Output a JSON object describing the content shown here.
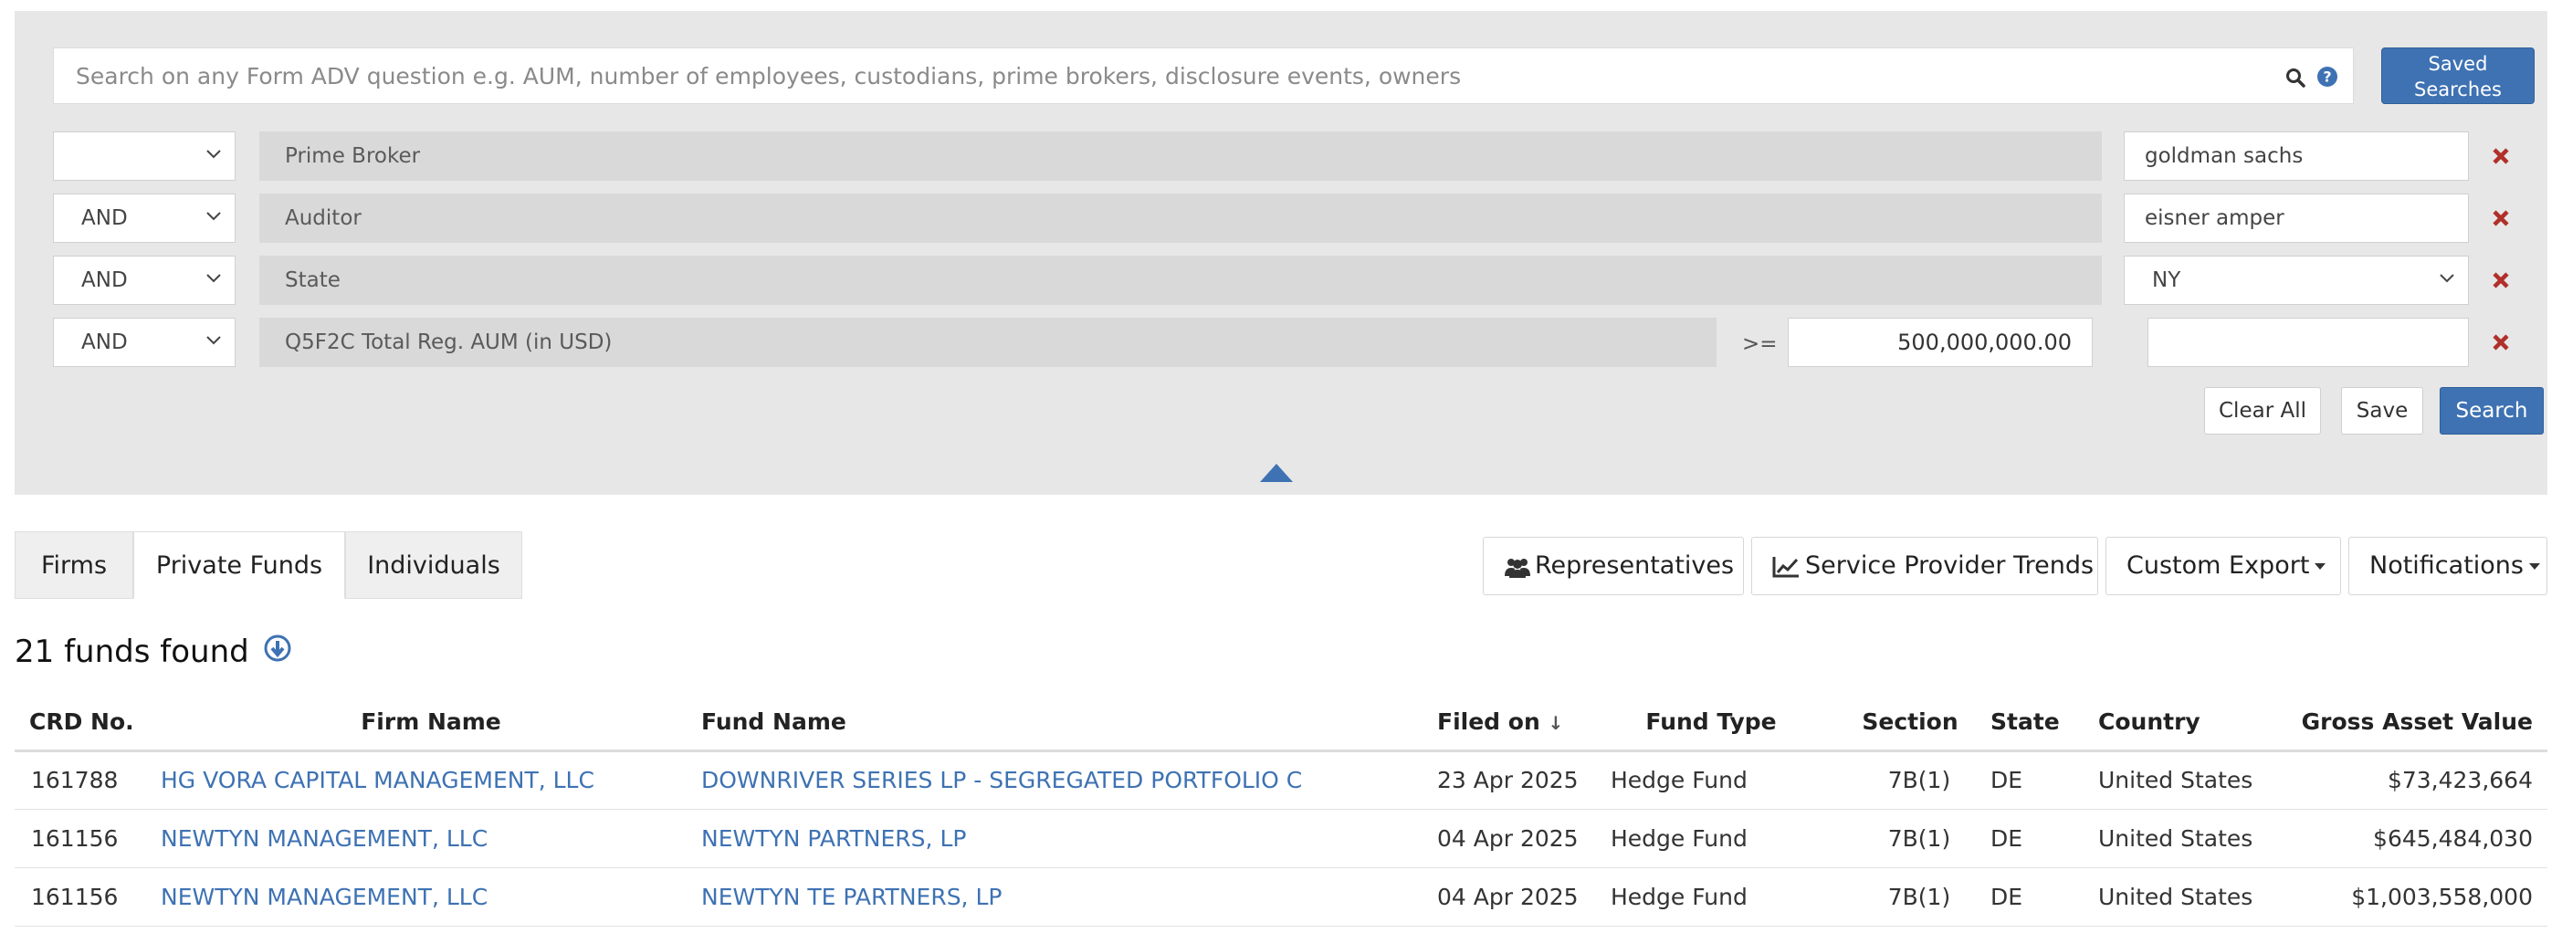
{
  "search": {
    "placeholder": "Search on any Form ADV question e.g. AUM, number of employees, custodians, prime brokers, disclosure events, owners",
    "saved_searches_line1": "Saved",
    "saved_searches_line2": "Searches",
    "search_icon": "magnifier-icon",
    "help_icon": "question-circle-icon"
  },
  "filters": [
    {
      "connector": "",
      "field": "Prime Broker",
      "value": "goldman sachs"
    },
    {
      "connector": "AND",
      "field": "Auditor",
      "value": "eisner amper"
    },
    {
      "connector": "AND",
      "field": "State",
      "value": "NY"
    },
    {
      "connector": "AND",
      "field": "Q5F2C Total Reg. AUM (in USD)",
      "operator": ">=",
      "value": "500,000,000.00",
      "value2": ""
    }
  ],
  "actions": {
    "clear_all": "Clear All",
    "save": "Save",
    "search": "Search"
  },
  "tabs": [
    {
      "label": "Firms",
      "active": false
    },
    {
      "label": "Private Funds",
      "active": true
    },
    {
      "label": "Individuals",
      "active": false
    }
  ],
  "toolbar": {
    "representatives": "Representatives",
    "service_provider_trends": "Service Provider Trends",
    "custom_export": "Custom Export",
    "notifications": "Notifications"
  },
  "results": {
    "count_label": "21 funds found"
  },
  "table": {
    "columns": [
      "CRD No.",
      "Firm Name",
      "Fund Name",
      "Filed on",
      "Fund Type",
      "Section",
      "State",
      "Country",
      "Gross Asset Value"
    ],
    "sort_indicator": "↓",
    "rows": [
      {
        "crd": "161788",
        "firm": "HG VORA CAPITAL MANAGEMENT, LLC",
        "fund": "DOWNRIVER SERIES LP - SEGREGATED PORTFOLIO C",
        "filed": "23 Apr 2025",
        "type": "Hedge Fund",
        "section": "7B(1)",
        "state": "DE",
        "country": "United States",
        "gav": "$73,423,664"
      },
      {
        "crd": "161156",
        "firm": "NEWTYN MANAGEMENT, LLC",
        "fund": "NEWTYN PARTNERS, LP",
        "filed": "04 Apr 2025",
        "type": "Hedge Fund",
        "section": "7B(1)",
        "state": "DE",
        "country": "United States",
        "gav": "$645,484,030"
      },
      {
        "crd": "161156",
        "firm": "NEWTYN MANAGEMENT, LLC",
        "fund": "NEWTYN TE PARTNERS, LP",
        "filed": "04 Apr 2025",
        "type": "Hedge Fund",
        "section": "7B(1)",
        "state": "DE",
        "country": "United States",
        "gav": "$1,003,558,000"
      }
    ]
  },
  "colors": {
    "accent": "#3e72b3",
    "remove": "#b0302a",
    "panel": "#e7e7e7",
    "field": "#d9d9d9"
  }
}
